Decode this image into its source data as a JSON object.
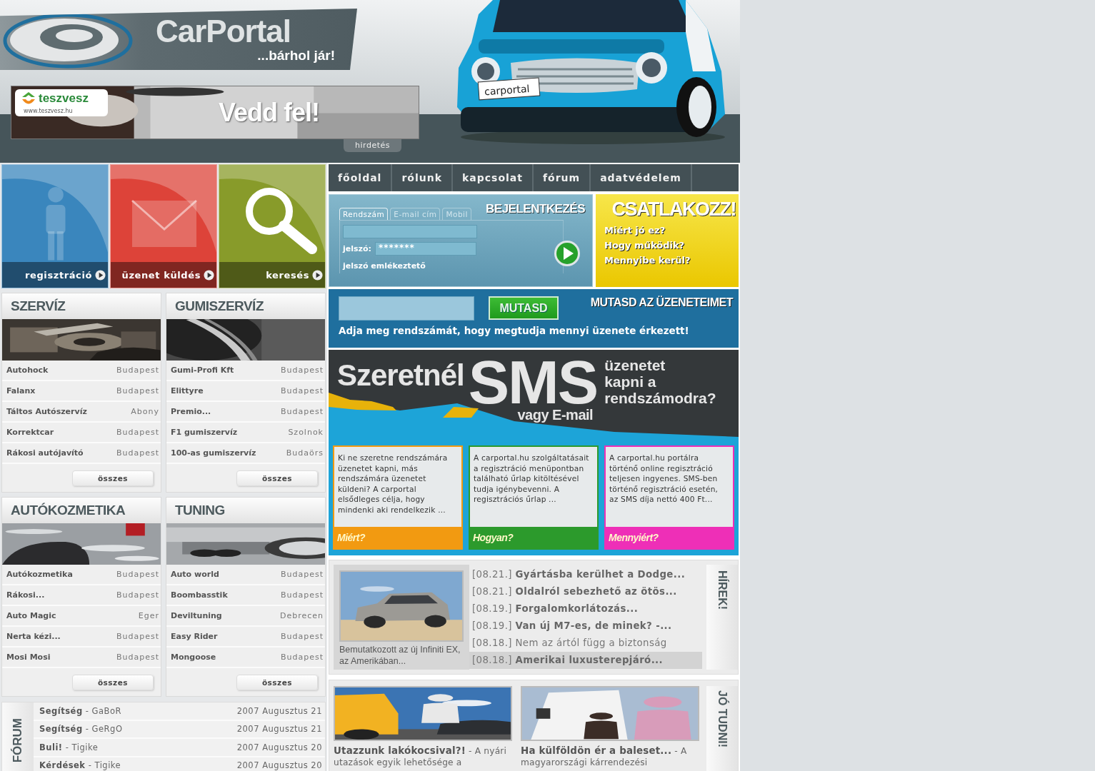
{
  "header": {
    "title": "CarPortal",
    "slogan": "...bárhol jár!",
    "ad": {
      "brand": "teszvesz",
      "brand_url": "www.teszvesz.hu",
      "headline": "Vedd fel!",
      "label": "hirdetés"
    },
    "car_plate": "carportal"
  },
  "tiles": [
    {
      "label": "regisztráció",
      "kind": "person",
      "color": "#3a86bd"
    },
    {
      "label": "üzenet küldés",
      "kind": "envelope",
      "color": "#dd4339"
    },
    {
      "label": "keresés",
      "kind": "magnifier",
      "color": "#889b2a"
    }
  ],
  "nav": [
    "főoldal",
    "rólunk",
    "kapcsolat",
    "fórum",
    "adatvédelem"
  ],
  "login": {
    "title": "BEJELENTKEZÉS",
    "tabs": [
      {
        "label": "Rendszám",
        "selected": true
      },
      {
        "label": "E-mail cím",
        "selected": false
      },
      {
        "label": "Mobil",
        "selected": false
      }
    ],
    "password_label": "jelszó:",
    "password_value": "*******",
    "reminder": "jelszó emlékeztető"
  },
  "join": {
    "title": "CSATLAKOZZ!",
    "links": [
      "Miért jó ez?",
      "Hogy működik?",
      "Mennyibe kerül?"
    ]
  },
  "messages": {
    "title": "MUTASD AZ ÜZENETEIMET",
    "button": "MUTASD",
    "hint": "Adja meg rendszámát, hogy megtudja mennyi üzenete érkezett!"
  },
  "sms_banner": {
    "lead": "Szeretnél",
    "big": "SMS",
    "alt": "vagy E-mail",
    "tail": "üzenetet\nkapni a\nrendszámodra?"
  },
  "info_cards": [
    {
      "text": "Ki ne szeretne rendszámára üzenetet kapni, más rendszámára üzenetet küldeni? A carportal elsődleges célja, hogy mindenki aki rendelkezik ...",
      "link": "Miért?",
      "color": "#f29a11"
    },
    {
      "text": "A carportal.hu szolgáltatásait a regisztráció menüpontban található űrlap kitöltésével tudja igénybevenni. A regisztrációs űrlap ...",
      "link": "Hogyan?",
      "color": "#2c9a2c"
    },
    {
      "text": "A carportal.hu portálra történő online regisztráció teljesen ingyenes. SMS-ben történő regisztráció esetén, az SMS díja nettó 400 Ft...",
      "link": "Mennyiért?",
      "color": "#ee2fb7"
    }
  ],
  "categories": [
    {
      "title": "SZERVÍZ",
      "more": "összes",
      "rows": [
        {
          "name": "Autohock",
          "city": "Budapest"
        },
        {
          "name": "Falanx",
          "city": "Budapest"
        },
        {
          "name": "Táltos Autószervíz",
          "city": "Abony"
        },
        {
          "name": "Korrektcar",
          "city": "Budapest"
        },
        {
          "name": "Rákosi autójavító",
          "city": "Budapest"
        }
      ]
    },
    {
      "title": "GUMISZERVÍZ",
      "more": "összes",
      "rows": [
        {
          "name": "Gumi-Profi Kft",
          "city": "Budapest"
        },
        {
          "name": "Elittyre",
          "city": "Budapest"
        },
        {
          "name": "Premio...",
          "city": "Budapest"
        },
        {
          "name": "F1 gumiszervíz",
          "city": "Szolnok"
        },
        {
          "name": "100-as gumiszervíz",
          "city": "Budaörs"
        }
      ]
    },
    {
      "title": "AUTÓKOZMETIKA",
      "more": "összes",
      "rows": [
        {
          "name": "Autókozmetika",
          "city": "Budapest"
        },
        {
          "name": "Rákosi...",
          "city": "Budapest"
        },
        {
          "name": "Auto Magic",
          "city": "Eger"
        },
        {
          "name": "Nerta kézi...",
          "city": "Budapest"
        },
        {
          "name": "Mosi Mosi",
          "city": "Budapest"
        }
      ]
    },
    {
      "title": "TUNING",
      "more": "összes",
      "rows": [
        {
          "name": "Auto world",
          "city": "Budapest"
        },
        {
          "name": "Boombasstik",
          "city": "Budapest"
        },
        {
          "name": "Deviltuning",
          "city": "Debrecen"
        },
        {
          "name": "Easy Rider",
          "city": "Budapest"
        },
        {
          "name": "Mongoose",
          "city": "Budapest"
        }
      ]
    }
  ],
  "forum": {
    "title": "FÓRUM",
    "topics": [
      {
        "topic": "**Segítség** - GaBoR",
        "date": "2007 Augusztus 21"
      },
      {
        "topic": "**Segítség** - GeRgO",
        "date": "2007 Augusztus 21"
      },
      {
        "topic": "**Buli!** - Tigike",
        "date": "2007 Augusztus 20"
      },
      {
        "topic": "**Kérdések** - Tigike",
        "date": "2007 Augusztus 20"
      }
    ]
  },
  "news": {
    "title": "HÍREK!",
    "featured_caption": "Bemutatkozott az új Infiniti EX, az Amerikában...",
    "items": [
      {
        "text": "[08.21.] **Gyártásba kerülhet a Dodge...**",
        "selected": false
      },
      {
        "text": "[08.21.] **Oldalról sebezhető az ötös...**",
        "selected": false
      },
      {
        "text": "[08.19.] **Forgalomkorlátozás...**",
        "selected": false
      },
      {
        "text": "[08.19.] **Van új M7-es, de minek? -...**",
        "selected": false
      },
      {
        "text": "[08.18.] Nem az ártól függ a biztonság",
        "selected": false
      },
      {
        "text": "[08.18.] **Amerikai luxusterepjáró...**",
        "selected": true
      }
    ]
  },
  "tips": {
    "title": "JÓ TUDNI!",
    "items": [
      {
        "text": "**Utazzunk lakókocsival?!** - A nyári utazások egyik lehetősége a"
      },
      {
        "text": "**Ha külföldön ér a baleset...** - A magyarországi kárrendezési"
      }
    ]
  }
}
